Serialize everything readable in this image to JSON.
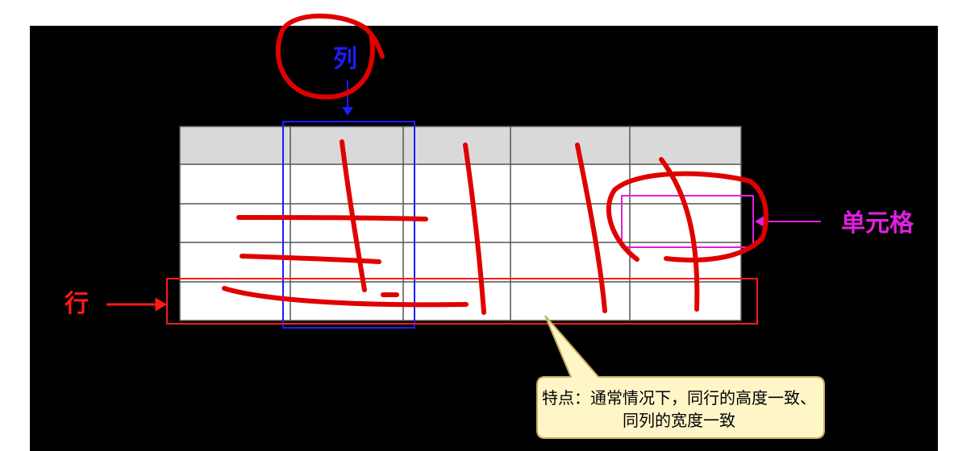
{
  "labels": {
    "column": "列",
    "cell": "单元格",
    "row": "行"
  },
  "callout": {
    "text": "特点：通常情况下，同行的高度一致、同列的宽度一致"
  },
  "colors": {
    "background": "#000000",
    "header_row": "#d9d9d9",
    "body_row": "#ffffff",
    "grid_line": "#555555",
    "column_highlight": "#1c1cff",
    "cell_highlight": "#e020e0",
    "row_highlight": "#ff1a1a",
    "handwriting": "#e00000",
    "callout_fill": "#fff6c8"
  },
  "table": {
    "rows": 5,
    "columns": 5,
    "header_rows": 1
  }
}
